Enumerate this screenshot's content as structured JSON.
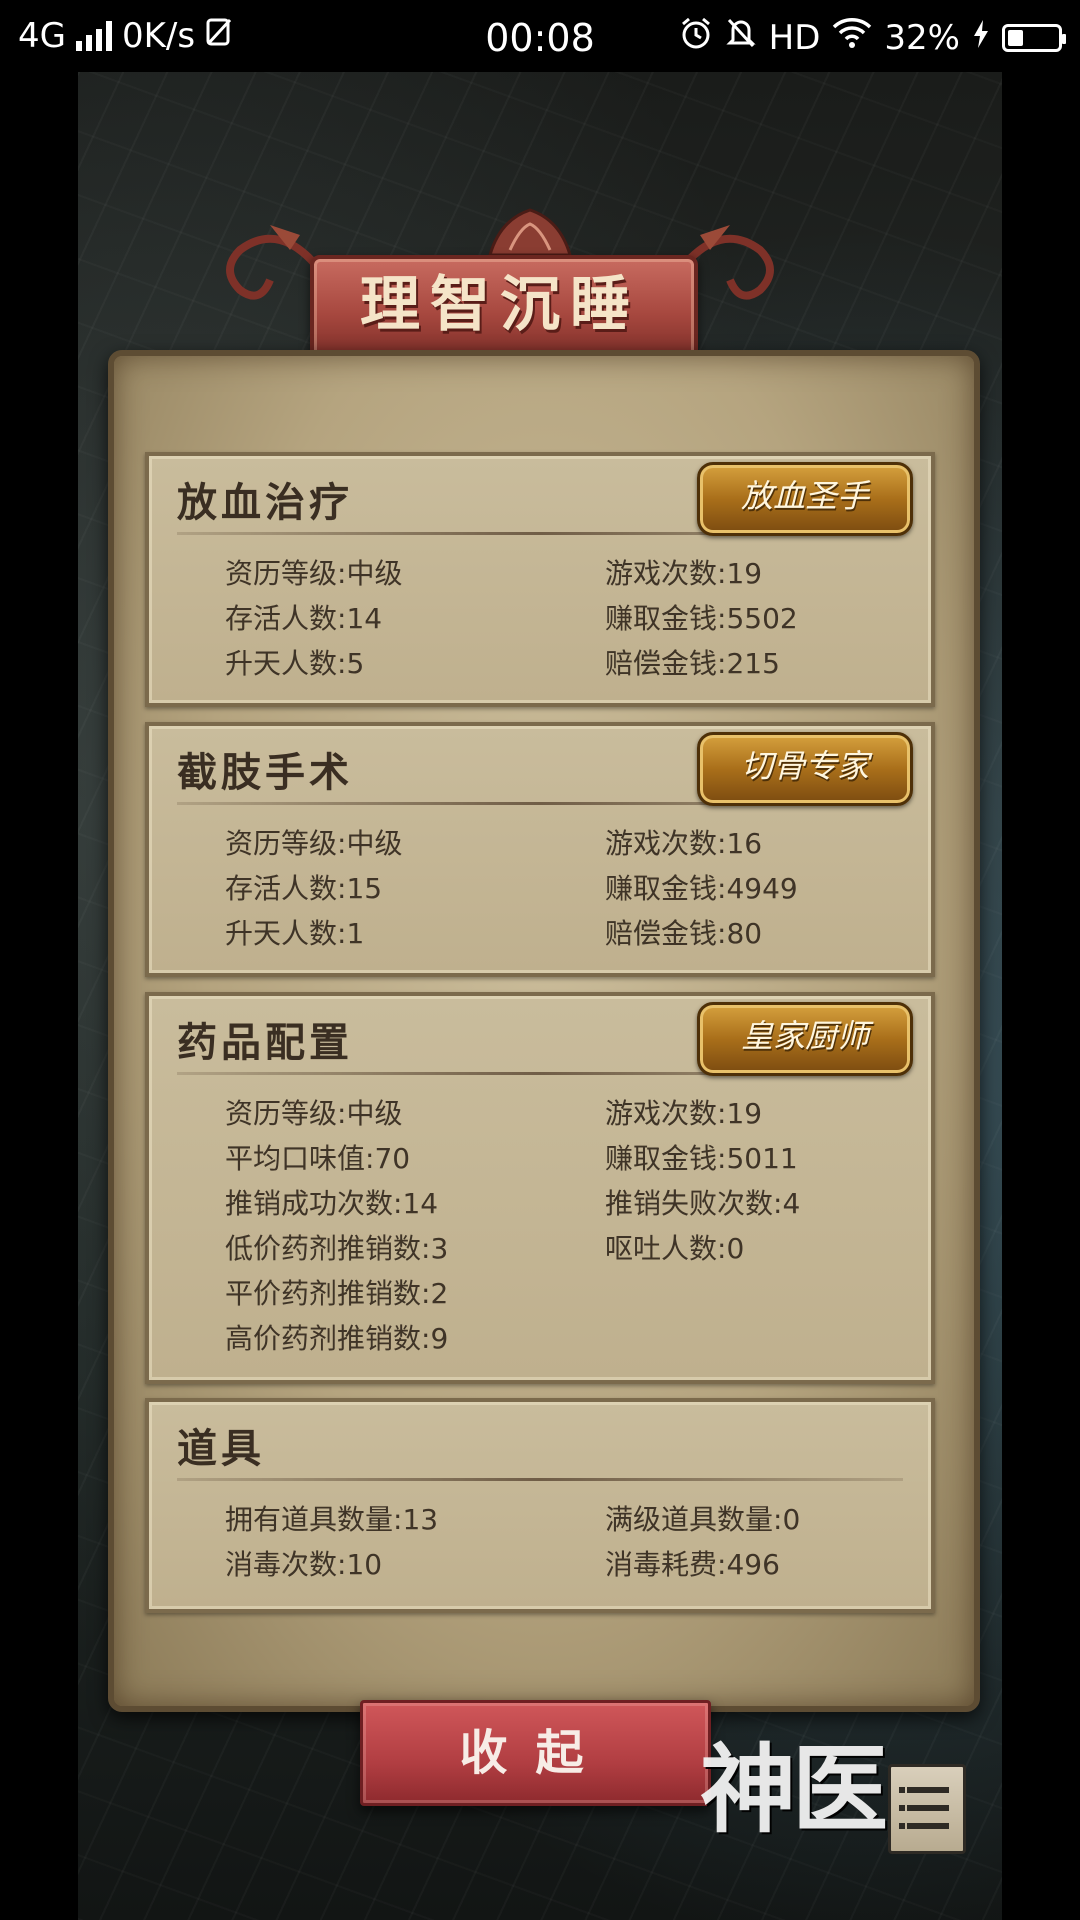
{
  "status_bar": {
    "network": "4G",
    "speed": "0K/s",
    "time": "00:08",
    "hd": "HD",
    "battery": "32%"
  },
  "title": "理智沉睡",
  "sections": [
    {
      "title": "放血治疗",
      "badge": "放血圣手",
      "stats": [
        {
          "k": "资历等级:",
          "v": "中级"
        },
        {
          "k": "游戏次数:",
          "v": "19"
        },
        {
          "k": "存活人数:",
          "v": "14"
        },
        {
          "k": "赚取金钱:",
          "v": "5502"
        },
        {
          "k": "升天人数:",
          "v": "5"
        },
        {
          "k": "赔偿金钱:",
          "v": "215"
        }
      ]
    },
    {
      "title": "截肢手术",
      "badge": "切骨专家",
      "stats": [
        {
          "k": "资历等级:",
          "v": "中级"
        },
        {
          "k": "游戏次数:",
          "v": "16"
        },
        {
          "k": "存活人数:",
          "v": "15"
        },
        {
          "k": "赚取金钱:",
          "v": "4949"
        },
        {
          "k": "升天人数:",
          "v": "1"
        },
        {
          "k": "赔偿金钱:",
          "v": "80"
        }
      ]
    },
    {
      "title": "药品配置",
      "badge": "皇家厨师",
      "stats": [
        {
          "k": "资历等级:",
          "v": "中级"
        },
        {
          "k": "游戏次数:",
          "v": "19"
        },
        {
          "k": "平均口味值:",
          "v": "70"
        },
        {
          "k": "赚取金钱:",
          "v": "5011"
        },
        {
          "k": "推销成功次数:",
          "v": "14"
        },
        {
          "k": "推销失败次数:",
          "v": "4"
        },
        {
          "k": "低价药剂推销数:",
          "v": "3"
        },
        {
          "k": "呕吐人数:",
          "v": "0"
        },
        {
          "k": "平价药剂推销数:",
          "v": "2"
        },
        {
          "k": "高价药剂推销数:",
          "v": "9"
        }
      ]
    },
    {
      "title": "道具",
      "stats": [
        {
          "k": "拥有道具数量:",
          "v": "13"
        },
        {
          "k": "满级道具数量:",
          "v": "0"
        },
        {
          "k": "消毒次数:",
          "v": "10"
        },
        {
          "k": "消毒耗费:",
          "v": "496"
        }
      ]
    }
  ],
  "collapse_label": "收起",
  "logo_text": "神医",
  "icons": {
    "signal": "signal-bars-icon",
    "sim": "sim-icon",
    "alarm": "alarm-icon",
    "mute": "bell-off-icon",
    "wifi": "wifi-icon",
    "charging": "charging-bolt-icon",
    "battery": "battery-icon",
    "menu": "menu-list-icon"
  },
  "colors": {
    "parchment": "#bfb08e",
    "badge_gold": "#a96f1a",
    "banner_red": "#a7483f",
    "button_red": "#b13e42"
  }
}
